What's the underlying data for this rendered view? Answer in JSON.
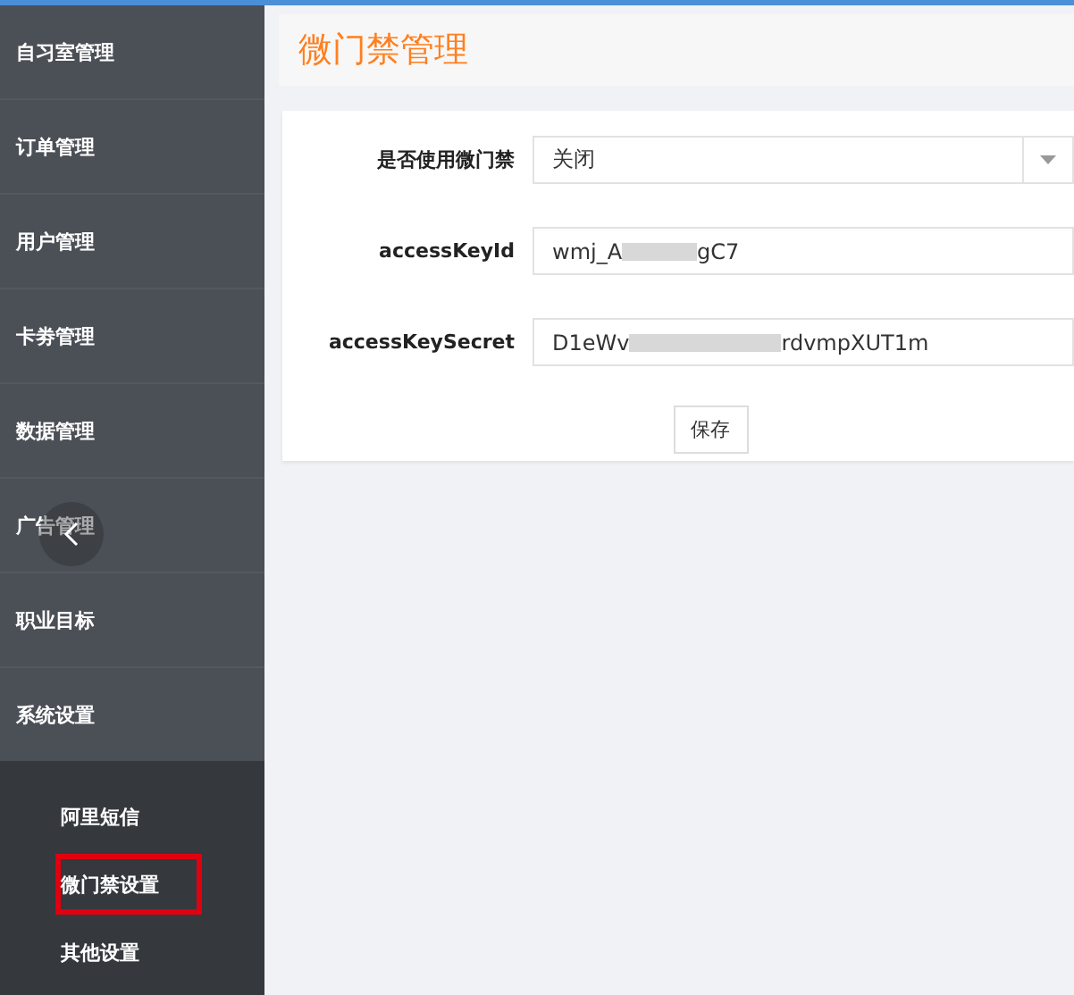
{
  "sidebar": {
    "items": [
      {
        "label": "自习室管理",
        "expanded": false
      },
      {
        "label": "订单管理",
        "expanded": false
      },
      {
        "label": "用户管理",
        "expanded": false
      },
      {
        "label": "卡劵管理",
        "expanded": false
      },
      {
        "label": "数据管理",
        "expanded": false
      },
      {
        "label": "广告管理",
        "expanded": false
      },
      {
        "label": "职业目标",
        "expanded": false
      },
      {
        "label": "系统设置",
        "expanded": true,
        "children": [
          {
            "label": "阿里短信",
            "highlighted": false
          },
          {
            "label": "微门禁设置",
            "highlighted": true
          },
          {
            "label": "其他设置",
            "highlighted": false
          }
        ]
      }
    ]
  },
  "page_title": "微门禁管理",
  "form": {
    "fields": [
      {
        "kind": "select",
        "label": "是否使用微门禁",
        "value": "关闭"
      },
      {
        "kind": "redacted",
        "label": "accessKeyId",
        "value_start": "wmj_A",
        "value_end": "gC7"
      },
      {
        "kind": "redacted",
        "label": "accessKeySecret",
        "value_start": "D1eWv",
        "value_end": "rdvmpXUT1m"
      }
    ],
    "save_button": "保存"
  }
}
